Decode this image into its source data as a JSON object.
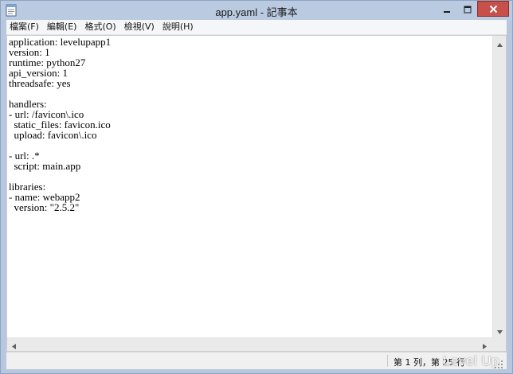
{
  "window": {
    "title": "app.yaml - 記事本",
    "app_icon": "notepad-icon",
    "controls": {
      "minimize_icon": "minimize-icon",
      "maximize_icon": "maximize-icon",
      "close_icon": "close-icon"
    }
  },
  "menu": {
    "items": [
      {
        "label": "檔案(F)"
      },
      {
        "label": "編輯(E)"
      },
      {
        "label": "格式(O)"
      },
      {
        "label": "檢視(V)"
      },
      {
        "label": "說明(H)"
      }
    ]
  },
  "editor": {
    "content": "application: levelupapp1\nversion: 1\nruntime: python27\napi_version: 1\nthreadsafe: yes\n\nhandlers:\n- url: /favicon\\.ico\n  static_files: favicon.ico\n  upload: favicon\\.ico\n\n- url: .*\n  script: main.app\n\nlibraries:\n- name: webapp2\n  version: \"2.5.2\""
  },
  "status": {
    "position": "第 1 列，第 25 行"
  },
  "watermark": {
    "text": "Level Up"
  },
  "colors": {
    "title_bar": "#b9cae1",
    "close_button": "#c7504a",
    "menu_bar": "#f5f6f7",
    "status_bar": "#f0f0f0"
  }
}
